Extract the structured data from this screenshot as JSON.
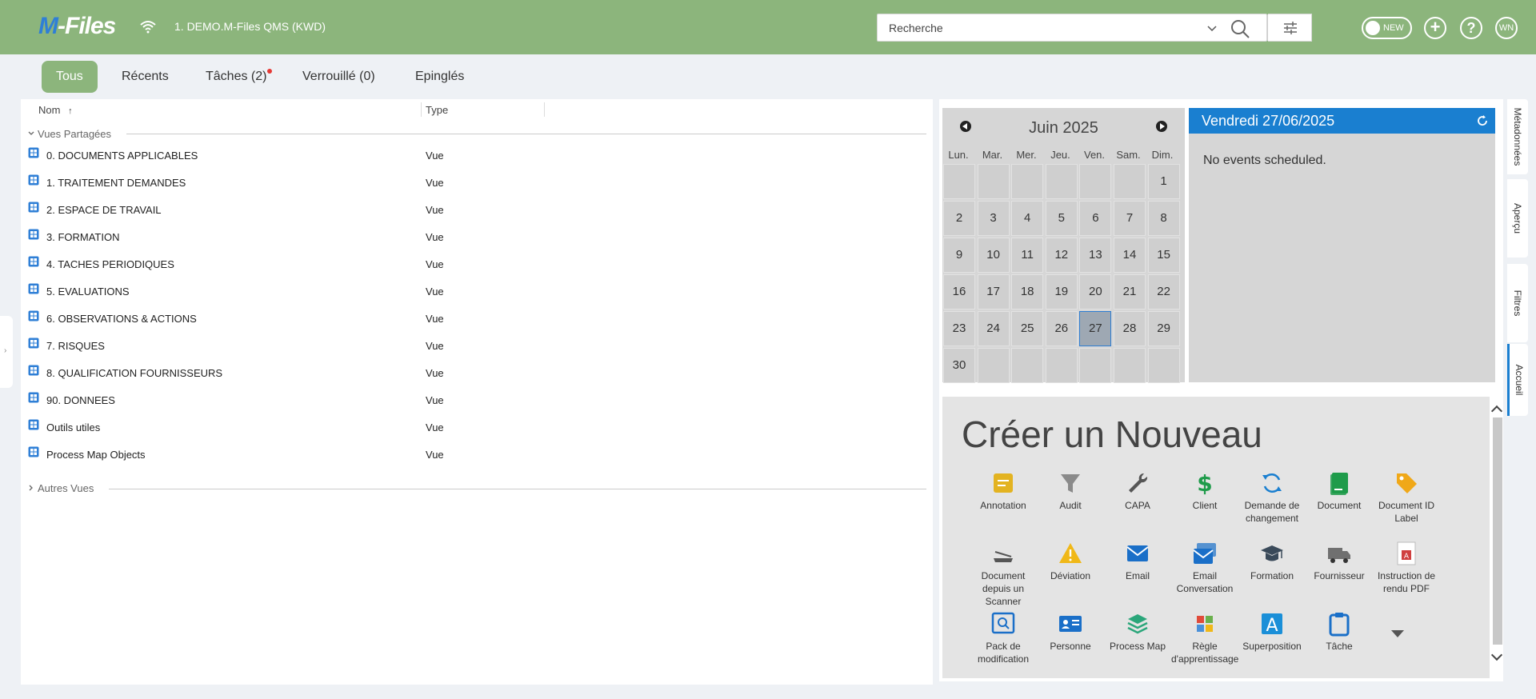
{
  "app": {
    "logo_m": "M",
    "logo_rest": "-Files",
    "vault": "1. DEMO.M-Files QMS (KWD)"
  },
  "search": {
    "placeholder": "Recherche"
  },
  "header": {
    "toggle_label": "NEW",
    "user_initials": "WN",
    "help": "?",
    "add": "+"
  },
  "tabs": [
    {
      "label": "Tous",
      "active": true
    },
    {
      "label": "Récents"
    },
    {
      "label": "Tâches (2)",
      "has_dot": true
    },
    {
      "label": "Verrouillé (0)"
    },
    {
      "label": "Epinglés"
    }
  ],
  "list": {
    "columns": {
      "name": "Nom",
      "sort_arrow": "↑",
      "type": "Type"
    },
    "group_shared": "Vues Partagées",
    "group_other": "Autres Vues",
    "rows": [
      {
        "name": "0. DOCUMENTS APPLICABLES",
        "type": "Vue"
      },
      {
        "name": "1. TRAITEMENT DEMANDES",
        "type": "Vue"
      },
      {
        "name": "2. ESPACE DE TRAVAIL",
        "type": "Vue"
      },
      {
        "name": "3. FORMATION",
        "type": "Vue"
      },
      {
        "name": "4. TACHES PERIODIQUES",
        "type": "Vue"
      },
      {
        "name": "5. EVALUATIONS",
        "type": "Vue"
      },
      {
        "name": "6. OBSERVATIONS & ACTIONS",
        "type": "Vue"
      },
      {
        "name": "7. RISQUES",
        "type": "Vue"
      },
      {
        "name": "8. QUALIFICATION FOURNISSEURS",
        "type": "Vue"
      },
      {
        "name": "90. DONNEES",
        "type": "Vue"
      },
      {
        "name": "Outils utiles",
        "type": "Vue"
      },
      {
        "name": "Process Map Objects",
        "type": "Vue"
      }
    ]
  },
  "calendar": {
    "month": "Juin 2025",
    "days_of_week": [
      "Lun.",
      "Mar.",
      "Mer.",
      "Jeu.",
      "Ven.",
      "Sam.",
      "Dim."
    ],
    "weeks": [
      [
        "",
        "",
        "",
        "",
        "",
        "",
        "1"
      ],
      [
        "2",
        "3",
        "4",
        "5",
        "6",
        "7",
        "8"
      ],
      [
        "9",
        "10",
        "11",
        "12",
        "13",
        "14",
        "15"
      ],
      [
        "16",
        "17",
        "18",
        "19",
        "20",
        "21",
        "22"
      ],
      [
        "23",
        "24",
        "25",
        "26",
        "27",
        "28",
        "29"
      ],
      [
        "30",
        "",
        "",
        "",
        "",
        "",
        ""
      ]
    ],
    "today": "27",
    "selected_date": "Vendredi 27/06/2025",
    "no_events": "No events scheduled."
  },
  "create": {
    "title": "Créer un Nouveau",
    "items": [
      {
        "label": "Annotation",
        "icon": "annotation-icon",
        "color": "#e3b321"
      },
      {
        "label": "Audit",
        "icon": "funnel-icon",
        "color": "#8a8a8a"
      },
      {
        "label": "CAPA",
        "icon": "wrench-icon",
        "color": "#555555"
      },
      {
        "label": "Client",
        "icon": "dollar-icon",
        "color": "#1e9b4a"
      },
      {
        "label": "Demande de changement",
        "icon": "refresh-cycle-icon",
        "color": "#1a7fd0"
      },
      {
        "label": "Document",
        "icon": "document-icon",
        "color": "#1e9b4a"
      },
      {
        "label": "Document ID Label",
        "icon": "tag-icon",
        "color": "#f0a818"
      },
      {
        "label": "Document depuis un Scanner",
        "icon": "scanner-icon",
        "color": "#555555"
      },
      {
        "label": "Déviation",
        "icon": "warning-icon",
        "color": "#f0b818"
      },
      {
        "label": "Email",
        "icon": "email-icon",
        "color": "#1a6fc8"
      },
      {
        "label": "Email Conversation",
        "icon": "email-conversation-icon",
        "color": "#1a6fc8"
      },
      {
        "label": "Formation",
        "icon": "graduation-cap-icon",
        "color": "#3a4a5a"
      },
      {
        "label": "Fournisseur",
        "icon": "truck-icon",
        "color": "#707070"
      },
      {
        "label": "Instruction de rendu PDF",
        "icon": "pdf-icon",
        "color": "#d04040"
      },
      {
        "label": "Pack de modification",
        "icon": "search-document-icon",
        "color": "#1a6fc8"
      },
      {
        "label": "Personne",
        "icon": "id-card-icon",
        "color": "#1a6fc8"
      },
      {
        "label": "Process Map",
        "icon": "layers-icon",
        "color": "#2aa67a"
      },
      {
        "label": "Règle d'apprentissage",
        "icon": "grid-icon",
        "color": "#4a90d9"
      },
      {
        "label": "Superposition",
        "icon": "letter-a-icon",
        "color": "#1a8fd8"
      },
      {
        "label": "Tâche",
        "icon": "clipboard-icon",
        "color": "#1a6fc8"
      }
    ]
  },
  "side_tabs": [
    {
      "label": "Métadonnées"
    },
    {
      "label": "Aperçu"
    },
    {
      "label": "Filtres"
    },
    {
      "label": "Accueil",
      "active": true
    }
  ]
}
